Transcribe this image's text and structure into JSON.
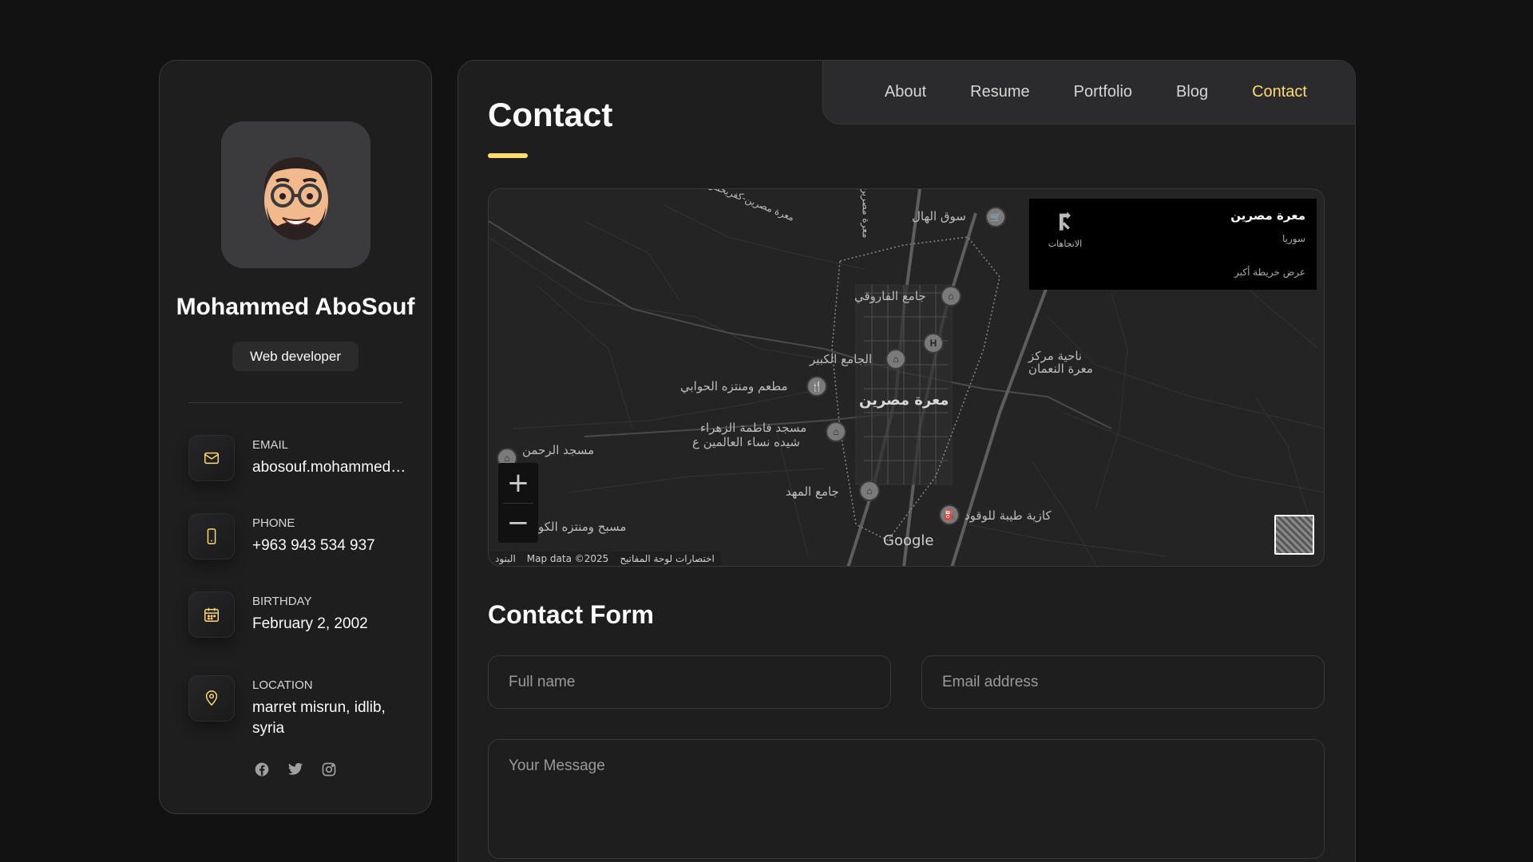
{
  "sidebar": {
    "name": "Mohammed AboSouf",
    "title": "Web developer",
    "contacts": [
      {
        "label": "Email",
        "value": "abosouf.mohammed@gmail.com",
        "icon": "mail-icon"
      },
      {
        "label": "Phone",
        "value": "+963 943 534 937",
        "icon": "phone-icon"
      },
      {
        "label": "Birthday",
        "value": "February 2, 2002",
        "icon": "calendar-icon"
      },
      {
        "label": "Location",
        "value": "marret misrun, idlib, syria",
        "icon": "location-pin-icon"
      }
    ],
    "socials": [
      "facebook-icon",
      "twitter-icon",
      "instagram-icon"
    ]
  },
  "nav": {
    "items": [
      {
        "label": "About"
      },
      {
        "label": "Resume"
      },
      {
        "label": "Portfolio"
      },
      {
        "label": "Blog"
      },
      {
        "label": "Contact"
      }
    ],
    "active": "Contact"
  },
  "main": {
    "title": "Contact",
    "map": {
      "card": {
        "place": "معرة مصرين",
        "country": "سوريا",
        "directions": "الاتجاهات",
        "bigger_map": "عرض خريطة أكبر"
      },
      "labels": {
        "souq": "سوق الهال",
        "farouqi": "جامع الفاروقي",
        "nahiya": "ناحية مركز",
        "maarat": "معرة النعمان",
        "kabir": "الجامع الكبير",
        "restaurant": "مطعم ومنتزه الحوابي",
        "town": "معرة مصرين",
        "fatima": "مسجد فاطمة الزهراء",
        "shuhada": "شيده نساء العالمين ع",
        "rahman": "مسجد الرحمن",
        "mahdi": "جامع المهد",
        "taiba": "كازية طيبة للوقود",
        "pool": "مسبح ومنتزه الكو",
        "road": "معرة مصرين-كفريحمرين",
        "road2": "معرة مصرين"
      },
      "zoom_in": "+",
      "zoom_out": "−",
      "google": "Google",
      "attribution": {
        "keys": "البنود",
        "data": "Map data ©2025",
        "shortcuts": "اختصارات لوحة المفاتيح"
      }
    },
    "form": {
      "title": "Contact Form",
      "fullname_placeholder": "Full name",
      "email_placeholder": "Email address",
      "message_placeholder": "Your Message"
    }
  },
  "colors": {
    "accent": "#ffdb70",
    "background": "#121212",
    "card": "#1e1e1f"
  }
}
